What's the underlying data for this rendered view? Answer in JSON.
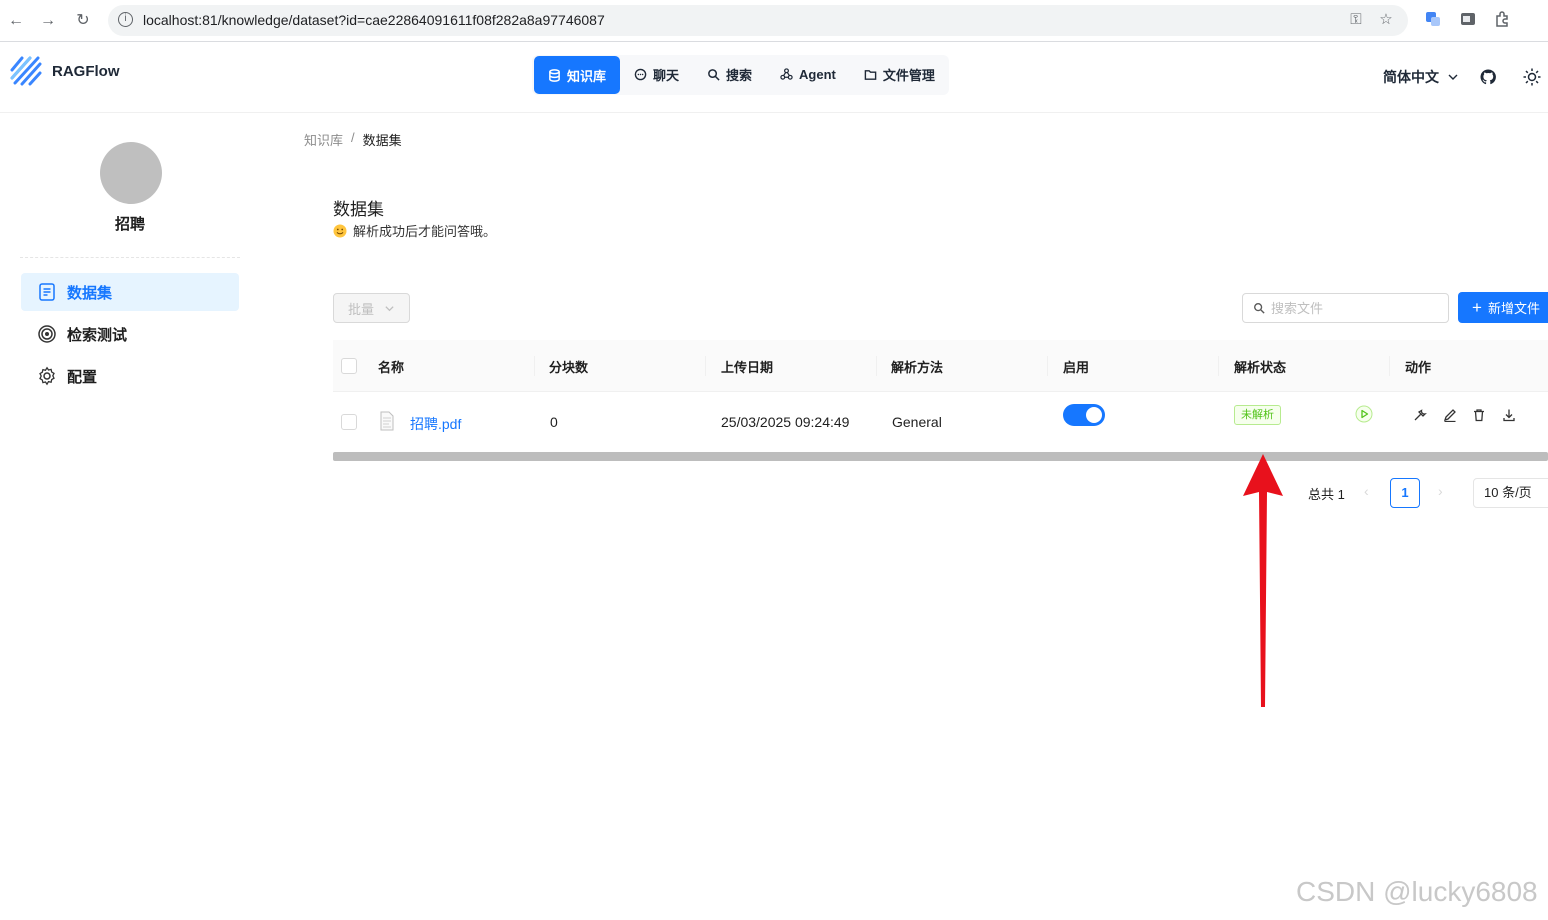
{
  "browser": {
    "url": "localhost:81/knowledge/dataset?id=cae22864091611f08f282a8a97746087"
  },
  "header": {
    "brand": "RAGFlow",
    "nav": [
      "知识库",
      "聊天",
      "搜索",
      "Agent",
      "文件管理"
    ],
    "language": "简体中文",
    "accent_color": "#1677ff"
  },
  "sidebar": {
    "kb_name": "招聘",
    "items": [
      "数据集",
      "检索测试",
      "配置"
    ]
  },
  "breadcrumb": {
    "root": "知识库",
    "separator": "/",
    "current": "数据集"
  },
  "page": {
    "title": "数据集",
    "tip": "解析成功后才能问答哦。"
  },
  "toolbar": {
    "bulk_label": "批量",
    "search_placeholder": "搜索文件",
    "add_label": "新增文件"
  },
  "table": {
    "columns": [
      "名称",
      "分块数",
      "上传日期",
      "解析方法",
      "启用",
      "解析状态",
      "动作"
    ],
    "rows": [
      {
        "name": "招聘.pdf",
        "chunks": "0",
        "upload_date": "25/03/2025 09:24:49",
        "parse_method": "General",
        "enabled": true,
        "status": "未解析"
      }
    ]
  },
  "pagination": {
    "total": "总共 1",
    "current_page": "1",
    "page_size": "10 条/页"
  },
  "watermark": "CSDN @lucky6808"
}
